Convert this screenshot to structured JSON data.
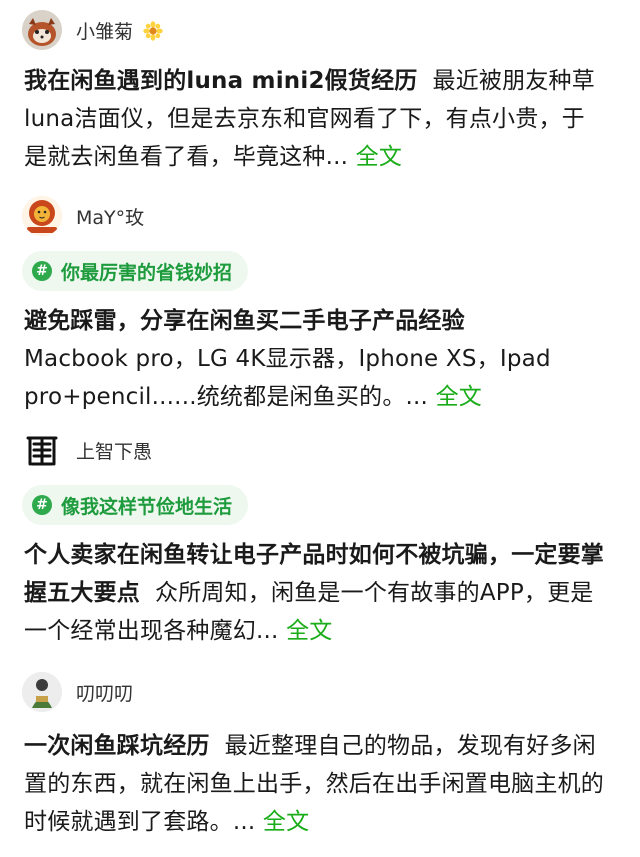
{
  "posts": [
    {
      "author": {
        "name": "小雏菊",
        "avatar": "red-panda-avatar",
        "name_emoji": "daisy-icon"
      },
      "title": "我在闲鱼遇到的luna mini2假货经历",
      "excerpt": "最近被朋友种草luna洁面仪，但是去京东和官网看了下，有点小贵，于是就去闲鱼看了看，毕竟这种",
      "ellipsis": "...",
      "more_label": "全文"
    },
    {
      "author": {
        "name": "MaY°玫",
        "avatar": "lion-avatar"
      },
      "topic": "你最厉害的省钱妙招",
      "title": "避免踩雷，分享在闲鱼买二手电子产品经验",
      "excerpt": "Macbook pro，LG 4K显示器，Iphone XS，Ipad pro+pencil......统统都是闲鱼买的。",
      "ellipsis": "...",
      "more_label": "全文"
    },
    {
      "author": {
        "name": "上智下愚",
        "avatar": "calligraphy-avatar"
      },
      "topic": "像我这样节俭地生活",
      "title": "个人卖家在闲鱼转让电子产品时如何不被坑骗，一定要掌握五大要点",
      "excerpt": "众所周知，闲鱼是一个有故事的APP，更是一个经常出现各种魔幻",
      "ellipsis": "...",
      "more_label": "全文"
    },
    {
      "author": {
        "name": "叨叨叨",
        "avatar": "figure-avatar"
      },
      "title": "一次闲鱼踩坑经历",
      "excerpt": "最近整理自己的物品，发现有好多闲置的东西，就在闲鱼上出手，然后在出手闲置电脑主机的时候就遇到了套路。",
      "ellipsis": "...",
      "more_label": "全文"
    }
  ],
  "colors": {
    "link": "#1aad19",
    "tag_bg": "#eef8ef",
    "tag_text": "#1d9b3d",
    "body_text": "#1a1a1a"
  }
}
